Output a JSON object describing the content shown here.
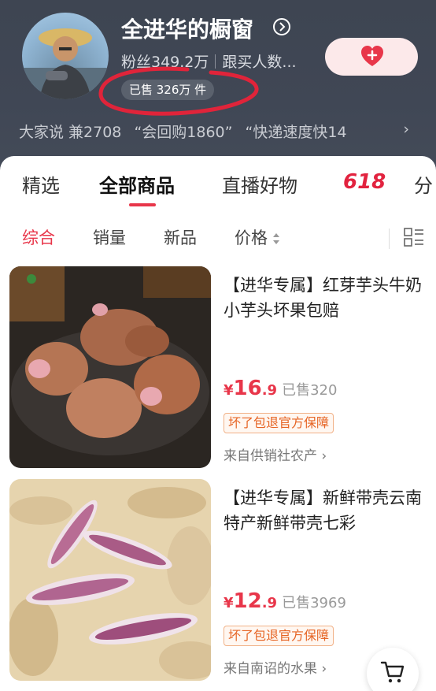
{
  "header": {
    "shop_name": "全进华的橱窗",
    "fans": "粉丝349.2万",
    "followers_buy": "跟买人数...",
    "sold_badge": "已售 326万 件",
    "reviews": [
      "大家说 兼2708",
      "“会回购1860”",
      "“快递速度快14"
    ]
  },
  "tabs": [
    "精选",
    "全部商品",
    "直播好物",
    "618",
    "分"
  ],
  "filters": [
    "综合",
    "销量",
    "新品",
    "价格"
  ],
  "products": [
    {
      "title": "【进华专属】红芽芋头牛奶小芋头坏果包赔",
      "price_currency": "¥",
      "price_int": "16",
      "price_dec": ".9",
      "sold": "已售320",
      "tag": "坏了包退官方保障",
      "source": "来自供销社农产 ›"
    },
    {
      "title": "【进华专属】新鲜带壳云南特产新鲜带壳七彩",
      "price_currency": "¥",
      "price_int": "12",
      "price_dec": ".9",
      "sold": "已售3969",
      "tag": "坏了包退官方保障",
      "source": "来自南诏的水果 ›"
    }
  ],
  "colors": {
    "accent": "#e8364a",
    "header_bg": "#404755",
    "tag_text": "#e66424"
  },
  "icons": [
    "chevron-right-icon",
    "heart-plus-icon",
    "sort-icon",
    "grid-list-icon",
    "cart-icon"
  ]
}
